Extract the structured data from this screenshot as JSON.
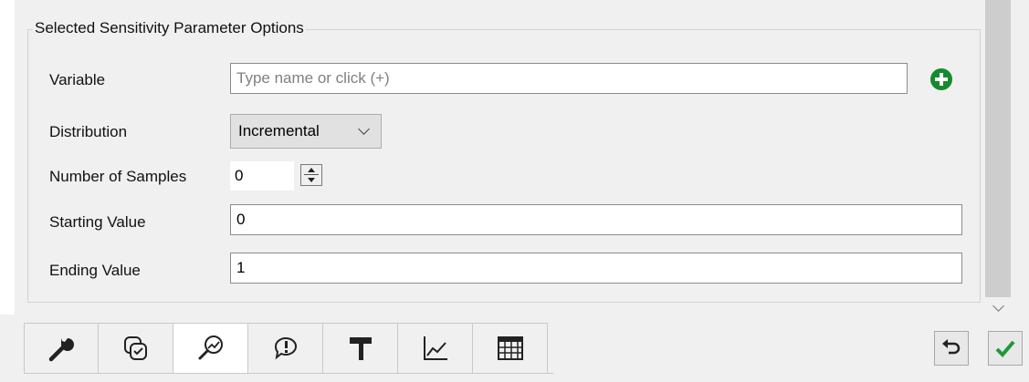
{
  "group": {
    "title": "Selected Sensitivity Parameter Options"
  },
  "fields": {
    "variable_label": "Variable",
    "variable_placeholder": "Type name or click (+)",
    "variable_value": "",
    "distribution_label": "Distribution",
    "distribution_value": "Incremental",
    "samples_label": "Number of Samples",
    "samples_value": "0",
    "start_label": "Starting Value",
    "start_value": "0",
    "end_label": "Ending Value",
    "end_value": "1"
  },
  "tabs": [
    {
      "icon": "wrench-icon"
    },
    {
      "icon": "checklist-icon"
    },
    {
      "icon": "magnifier-chart-icon",
      "active": true
    },
    {
      "icon": "alert-bubble-icon"
    },
    {
      "icon": "paint-roller-icon"
    },
    {
      "icon": "line-chart-icon"
    },
    {
      "icon": "table-icon"
    }
  ],
  "colors": {
    "accent_green": "#158a2e",
    "checkmark_green": "#1e9a3a"
  }
}
